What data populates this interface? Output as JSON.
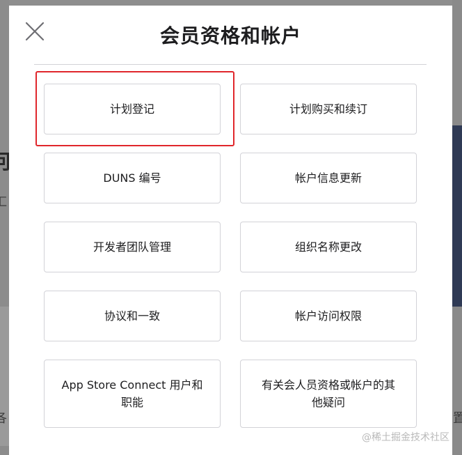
{
  "dialog": {
    "title": "会员资格和帐户",
    "close_icon": "close-icon"
  },
  "options": [
    {
      "label": "计划登记",
      "highlighted": true
    },
    {
      "label": "计划购买和续订"
    },
    {
      "label": "DUNS 编号"
    },
    {
      "label": "帐户信息更新"
    },
    {
      "label": "开发者团队管理"
    },
    {
      "label": "组织名称更改"
    },
    {
      "label": "协议和一致"
    },
    {
      "label": "帐户访问权限"
    },
    {
      "label": "App Store Connect 用户和职能"
    },
    {
      "label": "有关会人员资格或帐户的其他疑问"
    }
  ],
  "background": {
    "fragment_left_1": "何",
    "fragment_left_2": "汇",
    "fragment_left_3": "各",
    "fragment_right_1": "置"
  },
  "watermark": "@稀土掘金技术社区",
  "colors": {
    "highlight_border": "#e0262b",
    "card_border": "#d2d2d7",
    "text": "#1d1d1f"
  }
}
